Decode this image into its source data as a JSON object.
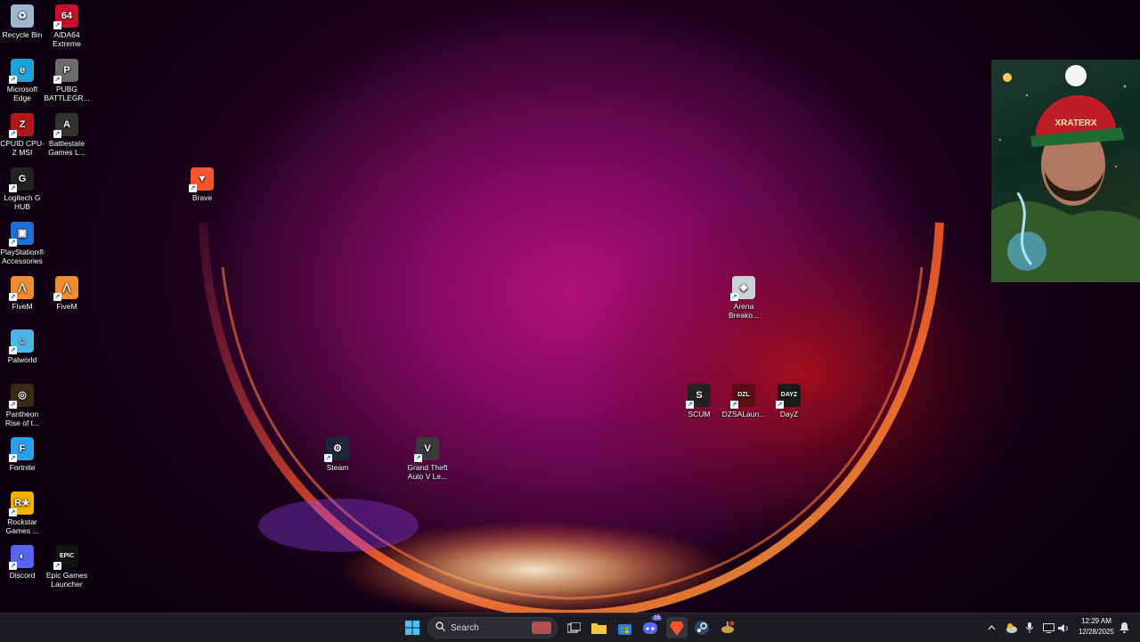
{
  "desktop_icons": [
    {
      "label": "Recycle Bin",
      "icon": "recycle-bin-icon",
      "color": "#9fb8d0",
      "glyph": "♻"
    },
    {
      "label": "AIDA64 Extreme",
      "icon": "aida64-icon",
      "color": "#c8102e",
      "glyph": "64"
    },
    {
      "label": "Microsoft Edge",
      "icon": "edge-icon",
      "color": "#1fa3d4",
      "glyph": "e"
    },
    {
      "label": "PUBG BATTLEGR...",
      "icon": "pubg-icon",
      "color": "#6b6b6b",
      "glyph": "P"
    },
    {
      "label": "CPUID CPU-Z MSI",
      "icon": "cpuz-icon",
      "color": "#b01818",
      "glyph": "Z"
    },
    {
      "label": "Battlestate Games L...",
      "icon": "battlestate-icon",
      "color": "#333333",
      "glyph": "A"
    },
    {
      "label": "Logitech G HUB",
      "icon": "logitech-icon",
      "color": "#222222",
      "glyph": "G"
    },
    {
      "label": "PlayStation® Accessories",
      "icon": "playstation-icon",
      "color": "#1e6fd6",
      "glyph": "▣"
    },
    {
      "label": "FiveM",
      "icon": "fivem-icon",
      "color": "#f28a2e",
      "glyph": "⋀"
    },
    {
      "label": "FiveM",
      "icon": "fivem-icon",
      "color": "#f28a2e",
      "glyph": "⋀"
    },
    {
      "label": "Palworld",
      "icon": "palworld-icon",
      "color": "#4db6e6",
      "glyph": "☺"
    },
    {
      "label": "Pantheon Rise of t...",
      "icon": "pantheon-icon",
      "color": "#3a2a14",
      "glyph": "◎"
    },
    {
      "label": "Fortnite",
      "icon": "fortnite-icon",
      "color": "#2aa0e8",
      "glyph": "F"
    },
    {
      "label": "Rockstar Games ...",
      "icon": "rockstar-icon",
      "color": "#f2b300",
      "glyph": "R★"
    },
    {
      "label": "Discord",
      "icon": "discord-icon",
      "color": "#5865f2",
      "glyph": "◐"
    },
    {
      "label": "Epic Games Launcher",
      "icon": "epic-games-icon",
      "color": "#111111",
      "glyph": "EPIC"
    },
    {
      "label": "Brave",
      "icon": "brave-icon",
      "color": "#fb542b",
      "glyph": "▼"
    },
    {
      "label": "Arena Breako...",
      "icon": "arena-breakout-icon",
      "color": "#c9d3d8",
      "glyph": "◆"
    },
    {
      "label": "SCUM",
      "icon": "scum-icon",
      "color": "#222222",
      "glyph": "S"
    },
    {
      "label": "DZSALaun...",
      "icon": "dzsa-launcher-icon",
      "color": "#5a0e10",
      "glyph": "DZL"
    },
    {
      "label": "DayZ",
      "icon": "dayz-icon",
      "color": "#1a1a1a",
      "glyph": "DAYZ"
    },
    {
      "label": "Steam",
      "icon": "steam-icon",
      "color": "#1b2838",
      "glyph": "⚙"
    },
    {
      "label": "Grand Theft Auto V Le...",
      "icon": "gtav-icon",
      "color": "#3a3a3a",
      "glyph": "V"
    }
  ],
  "widget": {
    "cap_text": "XRATERX"
  },
  "taskbar": {
    "search_placeholder": "Search",
    "badge_count": "15",
    "apps": [
      "start-icon",
      "task-view-icon",
      "file-explorer-icon",
      "microsoft-store-icon",
      "discord-icon",
      "brave-icon",
      "steam-icon",
      "game-icon"
    ],
    "tray": {
      "time": "12:29 AM",
      "date": "12/28/2025"
    }
  },
  "colors": {
    "accent": "#0067c0",
    "taskbar_bg": "#1c1c22"
  }
}
